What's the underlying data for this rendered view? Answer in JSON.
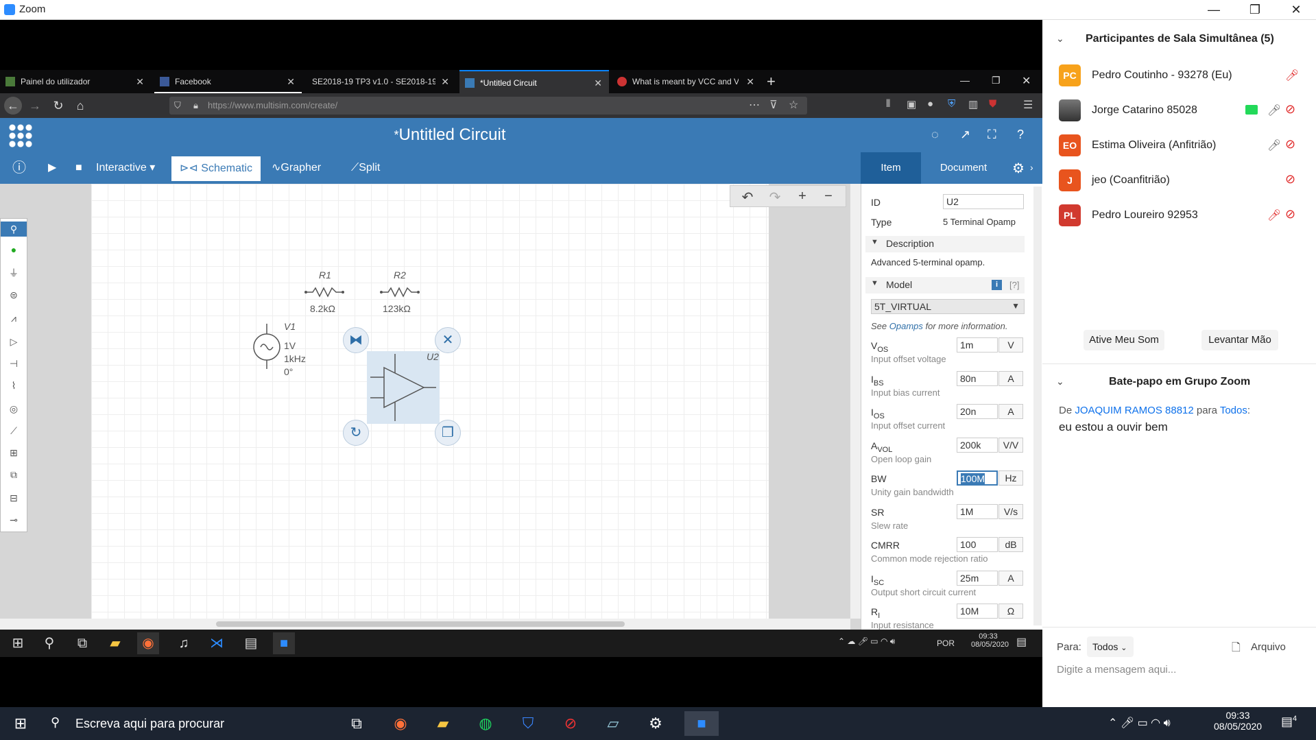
{
  "zoom": {
    "title": "Zoom",
    "minimize": "—",
    "restore": "❐",
    "close": "✕"
  },
  "firefox": {
    "tabs": [
      {
        "label": "Painel do utilizador"
      },
      {
        "label": "Facebook"
      },
      {
        "label": "SE2018-19 TP3 v1.0 - SE2018-19 T"
      },
      {
        "label": "*Untitled Circuit"
      },
      {
        "label": "What is meant by VCC and VEE"
      }
    ],
    "new_tab": "+",
    "url": "https://www.multisim.com/create/",
    "url_host": "multisim.com",
    "colors": {
      "tab_active_accent": "#0a84ff",
      "toolbar": "#323234"
    }
  },
  "multisim": {
    "title": "*Untitled Circuit",
    "title_mark": "*",
    "title_text": "Untitled Circuit",
    "toolbar": {
      "mode": "Interactive",
      "schematic": "Schematic",
      "grapher": "Grapher",
      "split": "Split"
    },
    "components": {
      "r1": {
        "label": "R1",
        "value": "8.2kΩ"
      },
      "r2": {
        "label": "R2",
        "value": "123kΩ"
      },
      "v1": {
        "label": "V1",
        "amplitude": "1V",
        "frequency": "1kHz",
        "phase": "0°"
      },
      "u2": {
        "label": "U2"
      }
    },
    "panel": {
      "tab_item": "Item",
      "tab_document": "Document",
      "id_label": "ID",
      "id_value": "U2",
      "type_label": "Type",
      "type_value": "5 Terminal Opamp",
      "description_header": "Description",
      "description_text": "Advanced 5-terminal opamp.",
      "model_header": "Model",
      "info_icon": "i",
      "help": "[?]",
      "model_value": "5T_VIRTUAL",
      "see_prefix": "See ",
      "see_link": "Opamps",
      "see_suffix": " for more information.",
      "params": [
        {
          "sym": "V",
          "sub": "OS",
          "value": "1m",
          "unit": "V",
          "desc": "Input offset voltage"
        },
        {
          "sym": "I",
          "sub": "BS",
          "value": "80n",
          "unit": "A",
          "desc": "Input bias current"
        },
        {
          "sym": "I",
          "sub": "OS",
          "value": "20n",
          "unit": "A",
          "desc": "Input offset current"
        },
        {
          "sym": "A",
          "sub": "VOL",
          "value": "200k",
          "unit": "V/V",
          "desc": "Open loop gain"
        },
        {
          "sym": "BW",
          "sub": "",
          "value": "100M",
          "unit": "Hz",
          "desc": "Unity gain bandwidth"
        },
        {
          "sym": "SR",
          "sub": "",
          "value": "1M",
          "unit": "V/s",
          "desc": "Slew rate"
        },
        {
          "sym": "CMRR",
          "sub": "",
          "value": "100",
          "unit": "dB",
          "desc": "Common mode rejection ratio"
        },
        {
          "sym": "I",
          "sub": "SC",
          "value": "25m",
          "unit": "A",
          "desc": "Output short circuit current"
        },
        {
          "sym": "R",
          "sub": "I",
          "value": "10M",
          "unit": "Ω",
          "desc": "Input resistance"
        }
      ]
    },
    "colors": {
      "header": "#3a7ab5",
      "item_tab": "#1f5f99",
      "link": "#2f6fa8"
    }
  },
  "taskbar_inner": {
    "lang": "POR",
    "time": "09:33",
    "date": "08/05/2020"
  },
  "zoom_panel": {
    "participants_title": "Participantes de Sala Simultânea (5)",
    "participants": [
      {
        "initials": "PC",
        "name": "Pedro Coutinho - 93278 (Eu)",
        "color": "#f7a21b"
      },
      {
        "initials": "",
        "name": "Jorge Catarino 85028",
        "color": "#555555"
      },
      {
        "initials": "EO",
        "name": "Estima Oliveira (Anfitrião)",
        "color": "#e8541e"
      },
      {
        "initials": "J",
        "name": "jeo (Coanfitrião)",
        "color": "#e8541e"
      },
      {
        "initials": "PL",
        "name": "Pedro Loureiro 92953",
        "color": "#d13a2f"
      }
    ],
    "unmute_button": "Ative Meu Som",
    "raise_hand_button": "Levantar Mão",
    "chat_title": "Bate-papo em Grupo Zoom",
    "chat_from": "De ",
    "chat_sender": "JOAQUIM RAMOS 88812",
    "chat_to": " para ",
    "chat_recipient": "Todos",
    "chat_colon": ":",
    "chat_message": "eu estou a ouvir bem",
    "to_label": "Para:",
    "to_value": "Todos",
    "file_label": "Arquivo",
    "input_placeholder": "Digite a mensagem aqui..."
  },
  "taskbar": {
    "search_placeholder": "Escreva aqui para procurar",
    "time": "09:33",
    "date": "08/05/2020",
    "notifications": "4"
  }
}
